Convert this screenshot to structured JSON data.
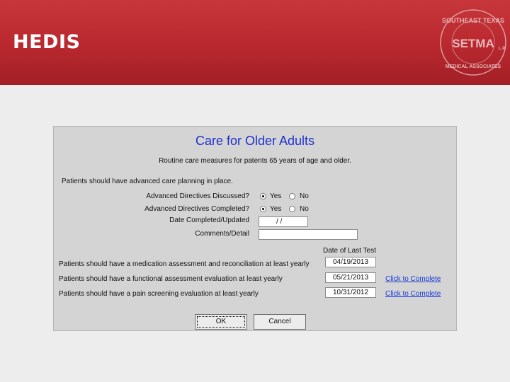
{
  "slide": {
    "title": "HEDIS"
  },
  "logo": {
    "top_text": "SOUTHEAST TEXAS",
    "center_text": "SETMA",
    "bottom_text": "MEDICAL ASSOCIATES",
    "suffix": "L.P."
  },
  "form": {
    "title": "Care for Older Adults",
    "subtitle": "Routine care measures for patents 65 years of age and older.",
    "planning_heading": "Patients should have advanced care planning in place.",
    "advanced_discussed": {
      "label": "Advanced Directives Discussed?",
      "yes": "Yes",
      "no": "No",
      "selected": "Yes"
    },
    "advanced_completed": {
      "label": "Advanced Directives Completed?",
      "yes": "Yes",
      "no": "No",
      "selected": "Yes"
    },
    "date_completed": {
      "label": "Date Completed/Updated",
      "value": "/ /"
    },
    "comments": {
      "label": "Comments/Detail",
      "value": ""
    },
    "last_test_header": "Date of Last Test",
    "rows": [
      {
        "text": "Patients should have a medication assessment and reconciliation at least yearly",
        "date": "04/19/2013",
        "link": ""
      },
      {
        "text": "Patients should have a functional assessment evaluation at least yearly",
        "date": "05/21/2013",
        "link": "Click to Complete"
      },
      {
        "text": "Patients should have a pain screening evaluation at least yearly",
        "date": "10/31/2012",
        "link": "Click to Complete"
      }
    ],
    "ok_label": "OK",
    "cancel_label": "Cancel"
  }
}
